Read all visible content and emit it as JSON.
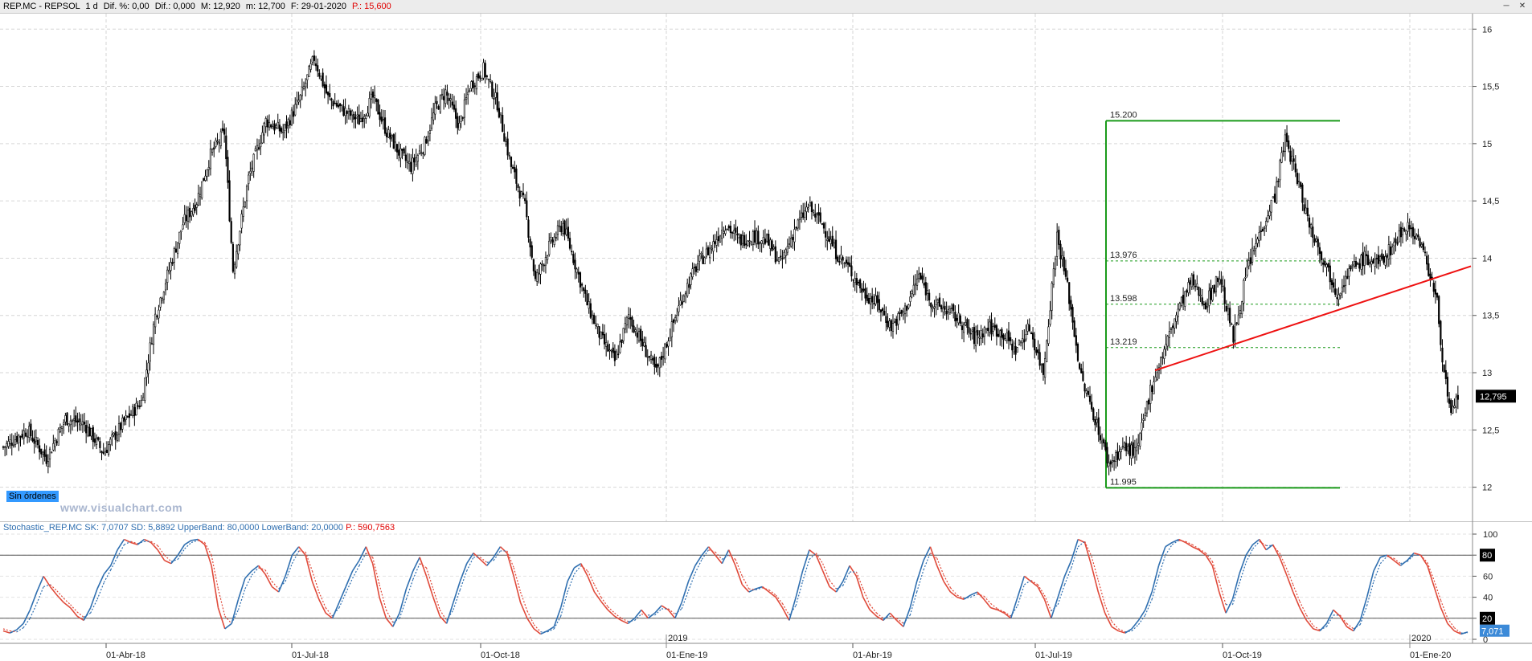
{
  "header": {
    "symbol": "REP.MC - REPSOL",
    "timeframe": "1 d",
    "dif_pct": "Dif. %: 0,00",
    "dif": "Dif.: 0,000",
    "max": "M: 12,920",
    "min": "m: 12,700",
    "date": "F: 29-01-2020",
    "price": "P.: 15,600"
  },
  "badges": {
    "orders": "Sin órdenes",
    "watermark": "www.visualchart.com"
  },
  "stoch_header": {
    "name": "Stochastic_REP.MC",
    "sk": "SK: 7,0707",
    "sd": "SD: 5,8892",
    "upper": "UpperBand: 80,0000",
    "lower": "LowerBand: 20,0000",
    "p": "P.: 590,7563"
  },
  "colors": {
    "fib": "#1a9a1a",
    "trendline": "#ee1111",
    "stoch_up": "#2f6fb0",
    "stoch_down": "#e04a3a"
  },
  "chart_data": [
    {
      "type": "candlestick",
      "y_ticks": [
        "16",
        "15,5",
        "15",
        "14,5",
        "14",
        "13,5",
        "13",
        "12,5",
        "12"
      ],
      "ylim": [
        11.78,
        16.1
      ],
      "x_ticks": [
        "01-Abr-18",
        "01-Jul-18",
        "01-Oct-18",
        "01-Ene-19",
        "01-Abr-19",
        "01-Jul-19",
        "01-Oct-19",
        "01-Ene-20"
      ],
      "year_markers": [
        "2019",
        "2020"
      ],
      "last_price": "12,795",
      "fib_levels": [
        {
          "label": "15.200",
          "value": 15.2
        },
        {
          "label": "13.976",
          "value": 13.976
        },
        {
          "label": "13.598",
          "value": 13.598
        },
        {
          "label": "13.219",
          "value": 13.219
        },
        {
          "label": "11.995",
          "value": 11.995
        }
      ],
      "trendline": {
        "from": 13.02,
        "to": 13.93
      },
      "close_path": [
        [
          0,
          12.35
        ],
        [
          14,
          12.5
        ],
        [
          25,
          12.25
        ],
        [
          36,
          12.6
        ],
        [
          47,
          12.55
        ],
        [
          58,
          12.3
        ],
        [
          69,
          12.55
        ],
        [
          80,
          12.75
        ],
        [
          88,
          13.5
        ],
        [
          96,
          13.9
        ],
        [
          104,
          14.3
        ],
        [
          112,
          14.5
        ],
        [
          120,
          14.9
        ],
        [
          128,
          15.1
        ],
        [
          133,
          13.9
        ],
        [
          142,
          14.7
        ],
        [
          152,
          15.2
        ],
        [
          162,
          15.1
        ],
        [
          172,
          15.4
        ],
        [
          180,
          15.75
        ],
        [
          188,
          15.4
        ],
        [
          196,
          15.3
        ],
        [
          206,
          15.2
        ],
        [
          214,
          15.4
        ],
        [
          222,
          15.1
        ],
        [
          230,
          14.9
        ],
        [
          236,
          14.8
        ],
        [
          244,
          15.0
        ],
        [
          250,
          15.3
        ],
        [
          256,
          15.45
        ],
        [
          264,
          15.15
        ],
        [
          270,
          15.5
        ],
        [
          278,
          15.65
        ],
        [
          286,
          15.35
        ],
        [
          294,
          14.8
        ],
        [
          302,
          14.45
        ],
        [
          308,
          13.8
        ],
        [
          316,
          14.1
        ],
        [
          324,
          14.3
        ],
        [
          332,
          13.9
        ],
        [
          338,
          13.6
        ],
        [
          346,
          13.3
        ],
        [
          354,
          13.1
        ],
        [
          362,
          13.5
        ],
        [
          370,
          13.25
        ],
        [
          378,
          13.0
        ],
        [
          386,
          13.35
        ],
        [
          394,
          13.7
        ],
        [
          402,
          13.95
        ],
        [
          410,
          14.1
        ],
        [
          418,
          14.3
        ],
        [
          426,
          14.15
        ],
        [
          434,
          14.2
        ],
        [
          442,
          14.15
        ],
        [
          450,
          13.95
        ],
        [
          458,
          14.25
        ],
        [
          466,
          14.45
        ],
        [
          474,
          14.3
        ],
        [
          482,
          14.05
        ],
        [
          490,
          13.9
        ],
        [
          498,
          13.7
        ],
        [
          506,
          13.6
        ],
        [
          514,
          13.4
        ],
        [
          522,
          13.55
        ],
        [
          530,
          13.85
        ],
        [
          538,
          13.6
        ],
        [
          546,
          13.55
        ],
        [
          554,
          13.45
        ],
        [
          562,
          13.3
        ],
        [
          570,
          13.4
        ],
        [
          578,
          13.35
        ],
        [
          586,
          13.2
        ],
        [
          594,
          13.4
        ],
        [
          602,
          13.0
        ],
        [
          610,
          14.2
        ],
        [
          616,
          13.75
        ],
        [
          624,
          12.95
        ],
        [
          632,
          12.6
        ],
        [
          640,
          12.2
        ],
        [
          648,
          12.35
        ],
        [
          656,
          12.3
        ],
        [
          664,
          12.85
        ],
        [
          672,
          13.2
        ],
        [
          680,
          13.55
        ],
        [
          688,
          13.8
        ],
        [
          696,
          13.6
        ],
        [
          704,
          13.85
        ],
        [
          712,
          13.3
        ],
        [
          720,
          13.9
        ],
        [
          728,
          14.25
        ],
        [
          736,
          14.55
        ],
        [
          742,
          15.05
        ],
        [
          748,
          14.75
        ],
        [
          756,
          14.3
        ],
        [
          764,
          14.0
        ],
        [
          772,
          13.7
        ],
        [
          780,
          13.9
        ],
        [
          788,
          14.0
        ],
        [
          796,
          13.95
        ],
        [
          804,
          14.1
        ],
        [
          812,
          14.3
        ],
        [
          820,
          14.15
        ],
        [
          826,
          13.85
        ],
        [
          830,
          13.6
        ],
        [
          834,
          13.0
        ],
        [
          838,
          12.6
        ],
        [
          842,
          12.8
        ]
      ]
    },
    {
      "type": "line",
      "title": "Stochastic",
      "y_ticks": [
        "100",
        "80",
        "60",
        "40",
        "20",
        "0"
      ],
      "ylim": [
        0,
        100
      ],
      "bands": {
        "upper": 80,
        "lower": 20
      },
      "upper_label": "80",
      "lower_label": "20",
      "last_value": "7,071",
      "series": [
        {
          "name": "SK",
          "values": [
            8,
            6,
            9,
            15,
            28,
            45,
            60,
            50,
            42,
            35,
            30,
            22,
            18,
            30,
            48,
            62,
            70,
            85,
            95,
            92,
            90,
            95,
            92,
            85,
            75,
            72,
            80,
            90,
            94,
            95,
            90,
            70,
            30,
            10,
            15,
            38,
            58,
            65,
            70,
            62,
            50,
            45,
            60,
            80,
            88,
            80,
            55,
            38,
            25,
            20,
            35,
            50,
            65,
            75,
            88,
            72,
            40,
            20,
            12,
            25,
            48,
            65,
            78,
            60,
            40,
            22,
            15,
            35,
            55,
            72,
            82,
            76,
            70,
            78,
            88,
            82,
            60,
            35,
            20,
            10,
            5,
            8,
            12,
            30,
            55,
            68,
            72,
            60,
            45,
            36,
            28,
            22,
            18,
            15,
            20,
            28,
            20,
            25,
            32,
            28,
            20,
            35,
            55,
            70,
            80,
            88,
            80,
            72,
            85,
            70,
            52,
            45,
            48,
            50,
            45,
            40,
            30,
            18,
            40,
            65,
            85,
            80,
            65,
            50,
            45,
            55,
            70,
            60,
            40,
            28,
            22,
            18,
            25,
            18,
            12,
            30,
            55,
            75,
            88,
            70,
            55,
            45,
            40,
            38,
            42,
            45,
            38,
            30,
            28,
            25,
            20,
            40,
            60,
            55,
            50,
            38,
            20,
            40,
            60,
            75,
            95,
            92,
            70,
            45,
            25,
            12,
            8,
            6,
            10,
            18,
            28,
            45,
            70,
            88,
            92,
            95,
            92,
            88,
            85,
            80,
            70,
            45,
            25,
            38,
            62,
            80,
            90,
            95,
            85,
            90,
            78,
            62,
            45,
            30,
            18,
            10,
            8,
            15,
            28,
            22,
            12,
            8,
            18,
            40,
            65,
            78,
            80,
            75,
            70,
            75,
            82,
            80,
            70,
            50,
            30,
            15,
            8,
            5,
            7
          ]
        },
        {
          "name": "SD",
          "values": [
            10,
            8,
            7,
            11,
            20,
            34,
            50,
            52,
            46,
            39,
            33,
            26,
            21,
            25,
            38,
            54,
            66,
            78,
            90,
            93,
            91,
            93,
            93,
            89,
            80,
            74,
            76,
            86,
            92,
            94,
            92,
            80,
            48,
            22,
            15,
            28,
            48,
            61,
            68,
            66,
            55,
            48,
            55,
            72,
            84,
            83,
            65,
            45,
            30,
            22,
            30,
            44,
            58,
            70,
            82,
            78,
            52,
            28,
            16,
            20,
            38,
            57,
            72,
            68,
            48,
            28,
            18,
            28,
            47,
            65,
            78,
            78,
            73,
            75,
            84,
            84,
            68,
            45,
            27,
            14,
            7,
            7,
            10,
            22,
            45,
            62,
            70,
            65,
            52,
            40,
            31,
            25,
            20,
            17,
            18,
            24,
            23,
            23,
            29,
            29,
            24,
            29,
            46,
            63,
            76,
            85,
            83,
            76,
            80,
            76,
            60,
            48,
            47,
            49,
            47,
            42,
            34,
            23,
            32,
            55,
            76,
            82,
            72,
            56,
            48,
            51,
            64,
            64,
            48,
            33,
            25,
            20,
            22,
            20,
            15,
            23,
            45,
            66,
            82,
            77,
            61,
            49,
            42,
            39,
            40,
            43,
            41,
            34,
            29,
            26,
            22,
            32,
            52,
            56,
            52,
            42,
            27,
            33,
            52,
            68,
            88,
            93,
            79,
            56,
            33,
            17,
            10,
            7,
            8,
            14,
            23,
            38,
            60,
            80,
            90,
            94,
            93,
            90,
            86,
            82,
            74,
            55,
            33,
            33,
            53,
            73,
            86,
            93,
            89,
            89,
            82,
            68,
            52,
            36,
            23,
            13,
            9,
            12,
            23,
            23,
            15,
            10,
            14,
            32,
            55,
            72,
            79,
            77,
            72,
            74,
            80,
            80,
            73,
            56,
            37,
            20,
            11,
            6,
            6
          ]
        }
      ]
    }
  ]
}
